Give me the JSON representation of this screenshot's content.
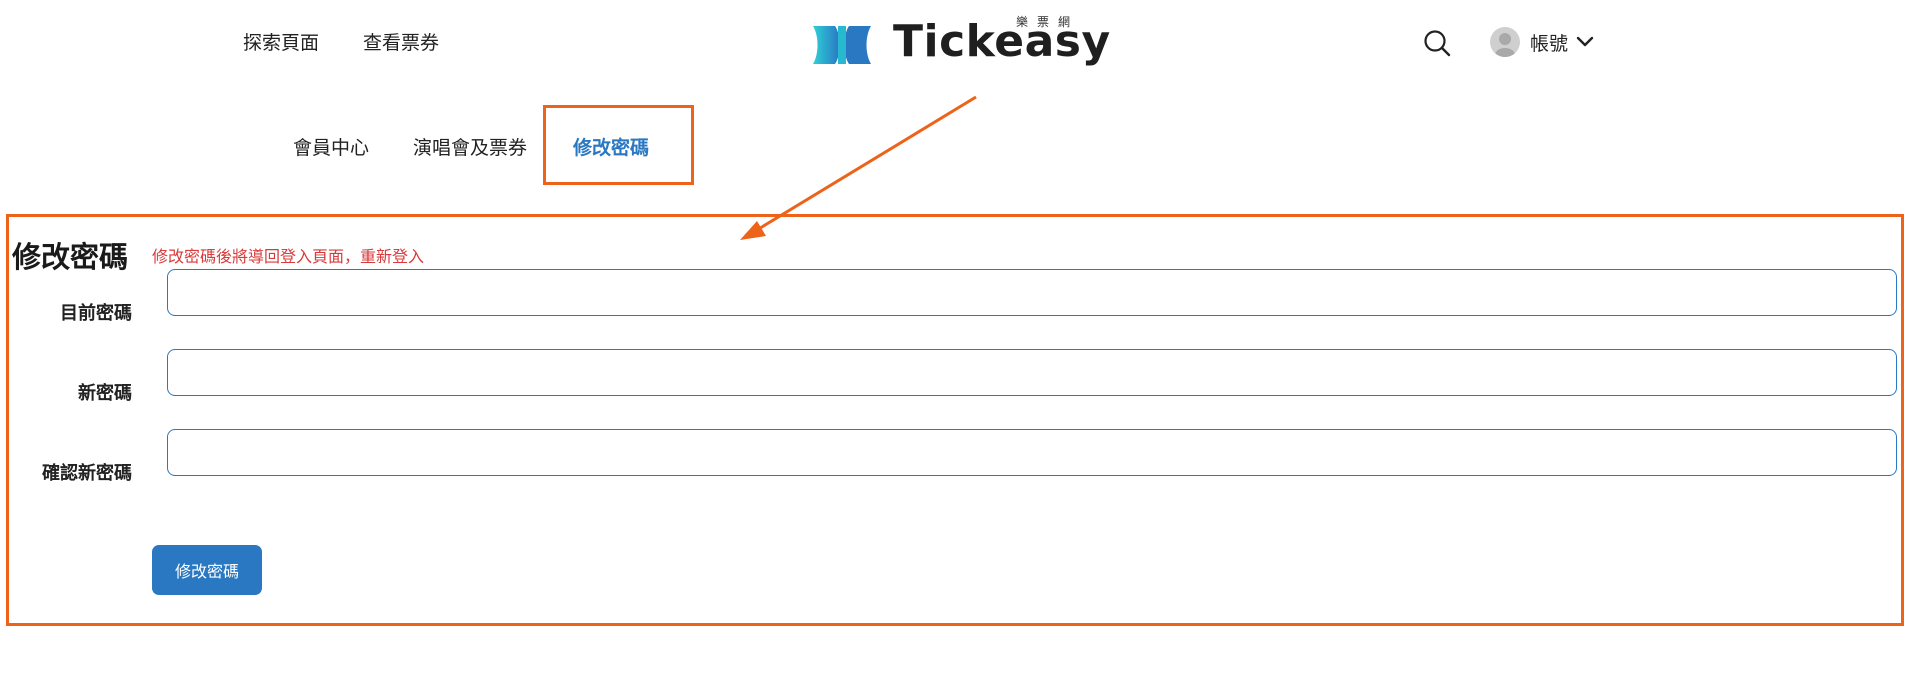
{
  "header": {
    "nav": [
      "探索頁面",
      "查看票券"
    ],
    "logo_text": "Tickeasy",
    "logo_subtitle": "樂票網",
    "account_label": "帳號"
  },
  "tabs": [
    {
      "label": "會員中心",
      "active": false
    },
    {
      "label": "演唱會及票券",
      "active": false
    },
    {
      "label": "修改密碼",
      "active": true
    }
  ],
  "form": {
    "title": "修改密碼",
    "notice": "修改密碼後將導回登入頁面，重新登入",
    "fields": [
      {
        "label": "目前密碼",
        "value": ""
      },
      {
        "label": "新密碼",
        "value": ""
      },
      {
        "label": "確認新密碼",
        "value": ""
      }
    ],
    "submit_label": "修改密碼"
  },
  "colors": {
    "accent": "#2a78c2",
    "annotation": "#ec6319",
    "notice": "#d93a3a",
    "logo_teal": "#27c3d6",
    "logo_blue": "#2a78c2"
  },
  "icons": [
    "search-icon",
    "avatar-icon",
    "chevron-down-icon",
    "logo-mark-icon"
  ]
}
